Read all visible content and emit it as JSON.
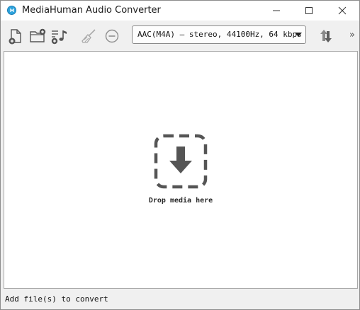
{
  "window": {
    "title": "MediaHuman Audio Converter",
    "app_icon": "mediahuman-logo-icon",
    "controls": [
      "minimize-icon",
      "maximize-icon",
      "close-icon"
    ]
  },
  "toolbar": {
    "buttons": [
      {
        "name": "add-file-button",
        "icon": "add-file-icon"
      },
      {
        "name": "add-folder-button",
        "icon": "add-folder-icon"
      },
      {
        "name": "add-itunes-playlist-button",
        "icon": "add-music-icon"
      },
      {
        "name": "clear-list-button",
        "icon": "broom-icon"
      },
      {
        "name": "remove-button",
        "icon": "minus-circle-icon"
      },
      {
        "name": "convert-button",
        "icon": "convert-arrows-icon"
      }
    ],
    "format": {
      "selected": "AAC(M4A) – stereo, 44100Hz, 64 kbps"
    },
    "overflow_label": "»"
  },
  "drop_area": {
    "label": "Drop media here",
    "icon": "drop-download-icon"
  },
  "status": {
    "text": "Add file(s) to convert"
  },
  "colors": {
    "accent": "#2ea3dd",
    "icon_gray": "#555555",
    "window_bg": "#f0f0f0"
  }
}
